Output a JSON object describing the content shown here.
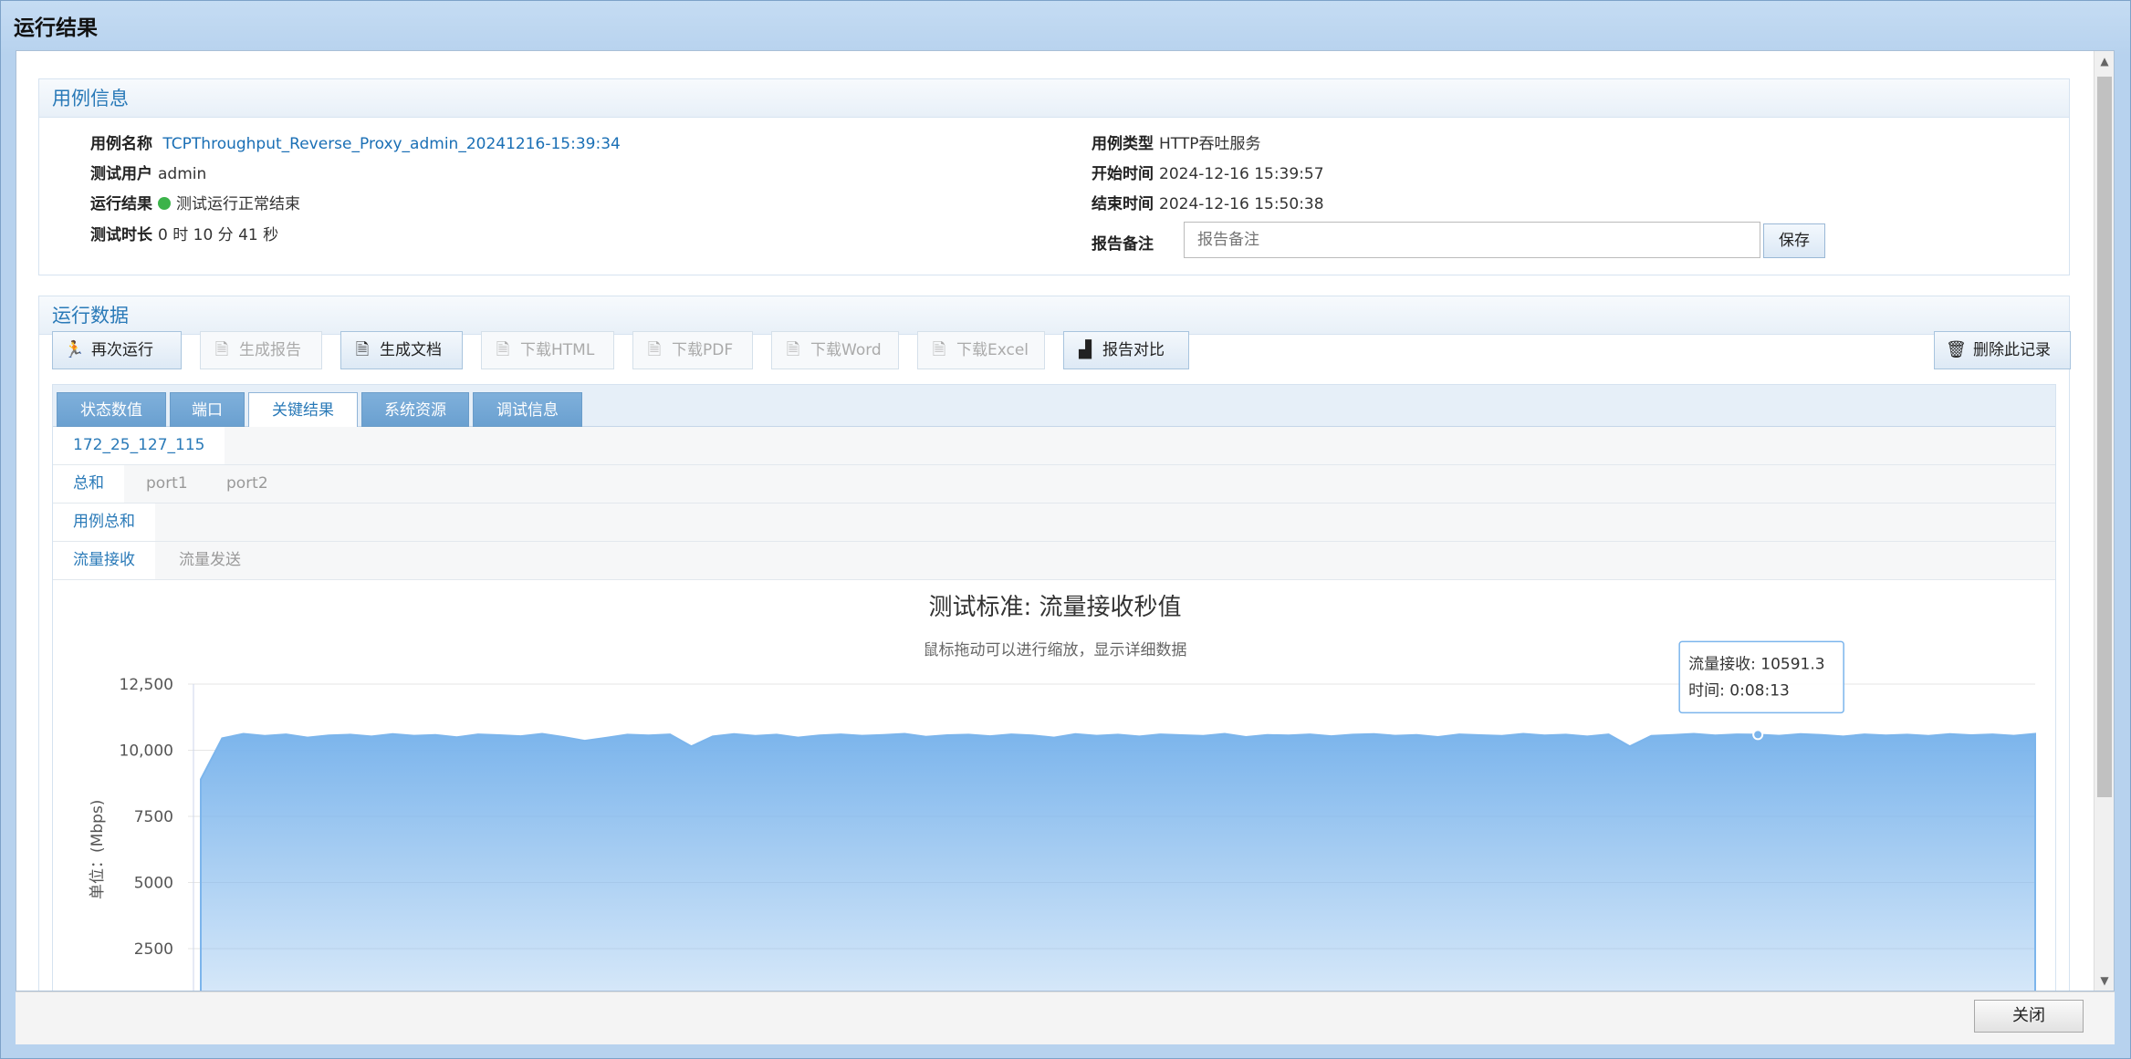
{
  "window": {
    "title": "运行结果"
  },
  "case_info": {
    "heading": "用例信息",
    "name_label": "用例名称",
    "name_value": "TCPThroughput_Reverse_Proxy_admin_20241216-15:39:34",
    "user_label": "测试用户",
    "user_value": "admin",
    "result_label": "运行结果",
    "result_value": "测试运行正常结束",
    "duration_label": "测试时长",
    "duration_value": "0 时 10 分 41 秒",
    "type_label": "用例类型",
    "type_value": "HTTP吞吐服务",
    "start_label": "开始时间",
    "start_value": "2024-12-16 15:39:57",
    "end_label": "结束时间",
    "end_value": "2024-12-16 15:50:38",
    "note_label": "报告备注",
    "note_placeholder": "报告备注",
    "save_label": "保存"
  },
  "run_data": {
    "heading": "运行数据",
    "toolbar": {
      "rerun": "再次运行",
      "gen_report": "生成报告",
      "gen_doc": "生成文档",
      "dl_html": "下载HTML",
      "dl_pdf": "下载PDF",
      "dl_word": "下载Word",
      "dl_excel": "下载Excel",
      "compare": "报告对比",
      "delete": "删除此记录"
    },
    "tabs": [
      "状态数值",
      "端口",
      "关键结果",
      "系统资源",
      "调试信息"
    ],
    "host": "172_25_127_115",
    "port_tabs": [
      "总和",
      "port1",
      "port2"
    ],
    "scope_tab": "用例总和",
    "flow_tabs": [
      "流量接收",
      "流量发送"
    ]
  },
  "chart_data": {
    "type": "area",
    "title": "测试标准: 流量接收秒值",
    "subtitle": "鼠标拖动可以进行缩放，显示详细数据",
    "ylabel": "单位：(Mbps)",
    "ylim": [
      0,
      12500
    ],
    "yticks": [
      "12,500",
      "10,000",
      "7500",
      "5000",
      "2500"
    ],
    "ytick_values": [
      12500,
      10000,
      7500,
      5000,
      2500
    ],
    "series": [
      {
        "values": [
          8900,
          10450,
          10620,
          10540,
          10600,
          10480,
          10560,
          10590,
          10520,
          10610,
          10550,
          10580,
          10490,
          10600,
          10570,
          10530,
          10620,
          10500,
          10360,
          10470,
          10590,
          10560,
          10600,
          10150,
          10520,
          10610,
          10540,
          10590,
          10480,
          10560,
          10600,
          10550,
          10580,
          10620,
          10510,
          10570,
          10590,
          10530,
          10600,
          10560,
          10480,
          10610,
          10550,
          10590,
          10520,
          10600,
          10570,
          10540,
          10620,
          10500,
          10580,
          10560,
          10600,
          10530,
          10590,
          10610,
          10550,
          10580,
          10500,
          10600,
          10570,
          10540,
          10620,
          10560,
          10590,
          10520,
          10600,
          10150,
          10540,
          10580,
          10620,
          10560,
          10600,
          10591,
          10550,
          10610,
          10580,
          10520,
          10600,
          10560,
          10590,
          10540,
          10610,
          10570,
          10600,
          10550,
          10620
        ]
      }
    ],
    "fill_color": "#7cb5ec",
    "tooltip": {
      "series_label": "流量接收: 10591.3",
      "time_label": "时间: 0:08:13",
      "point_index": 73
    }
  },
  "footer": {
    "close_label": "关闭"
  }
}
